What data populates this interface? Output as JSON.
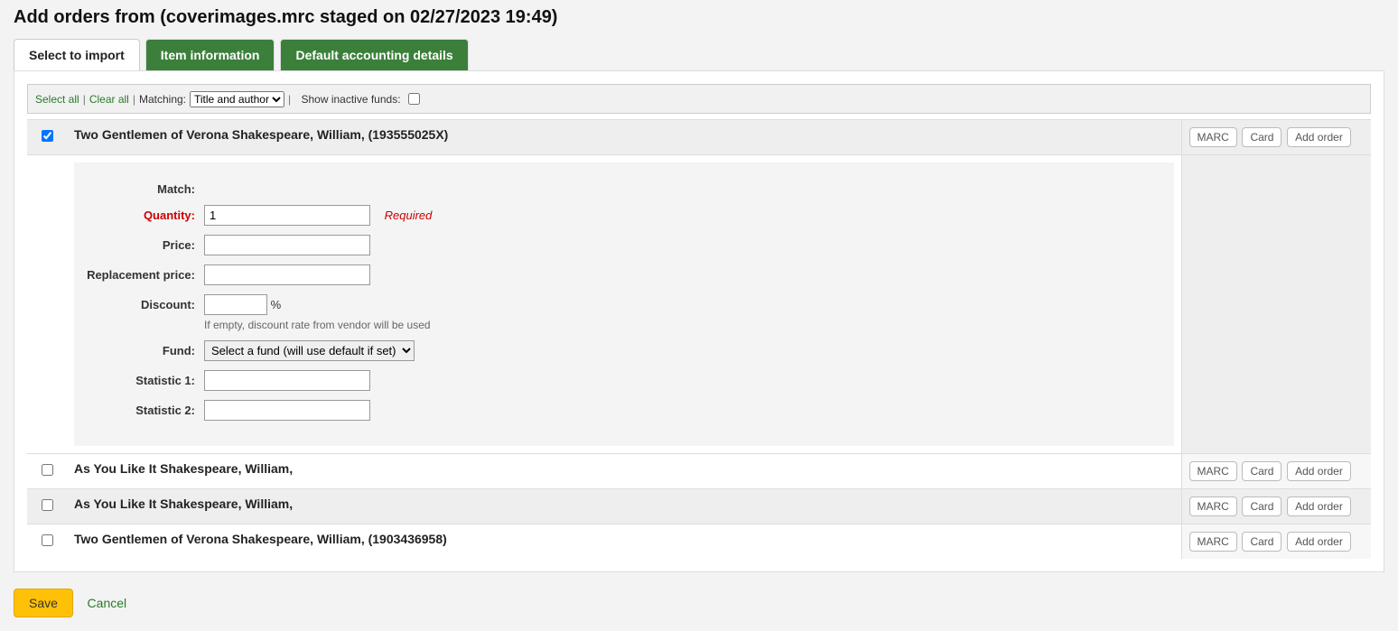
{
  "page_title": "Add orders from (coverimages.mrc staged on 02/27/2023 19:49)",
  "tabs": {
    "select": "Select to import",
    "item_info": "Item information",
    "accounting": "Default accounting details"
  },
  "toolbar": {
    "select_all": "Select all",
    "clear_all": "Clear all",
    "matching_label": "Matching:",
    "matching_value": "Title and author",
    "show_inactive_label": "Show inactive funds:"
  },
  "action_buttons": {
    "marc": "MARC",
    "card": "Card",
    "add_order": "Add order"
  },
  "records": [
    {
      "checked": true,
      "title": "Two Gentlemen of Verona Shakespeare, William, (193555025X)"
    },
    {
      "checked": false,
      "title": "As You Like It Shakespeare, William,"
    },
    {
      "checked": false,
      "title": "As You Like It Shakespeare, William,"
    },
    {
      "checked": false,
      "title": "Two Gentlemen of Verona Shakespeare, William, (1903436958)"
    }
  ],
  "detail_form": {
    "match_label": "Match:",
    "quantity_label": "Quantity:",
    "quantity_value": "1",
    "required_text": "Required",
    "price_label": "Price:",
    "replacement_price_label": "Replacement price:",
    "discount_label": "Discount:",
    "discount_suffix": "%",
    "discount_hint": "If empty, discount rate from vendor will be used",
    "fund_label": "Fund:",
    "fund_value": "Select a fund (will use default if set)",
    "stat1_label": "Statistic 1:",
    "stat2_label": "Statistic 2:"
  },
  "footer": {
    "save": "Save",
    "cancel": "Cancel"
  }
}
